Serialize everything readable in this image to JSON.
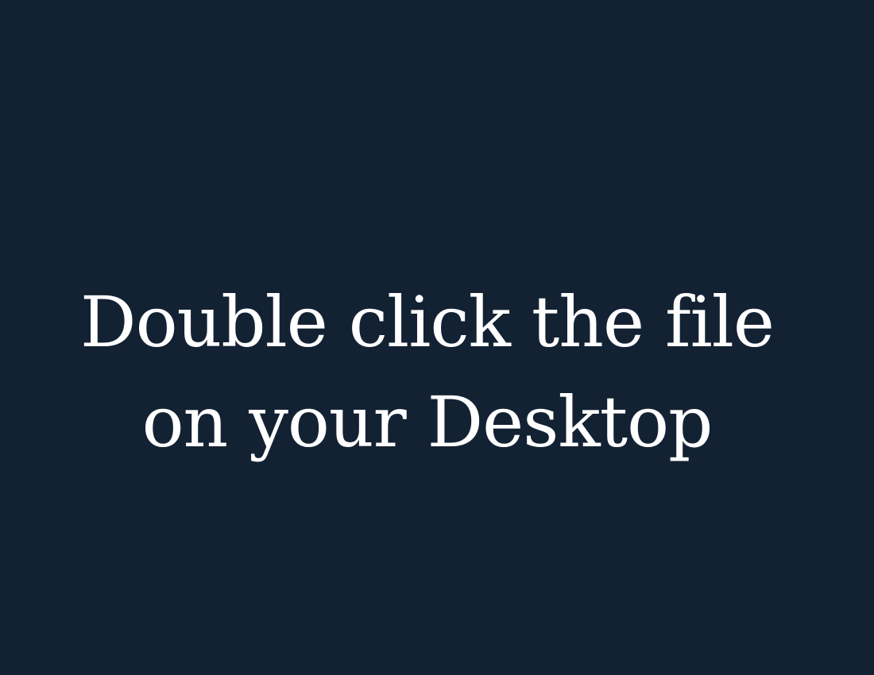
{
  "slide": {
    "background_color": "#132233",
    "text_color": "#ffffff",
    "message_lines": [
      "Double click the file",
      "on your Desktop"
    ]
  }
}
